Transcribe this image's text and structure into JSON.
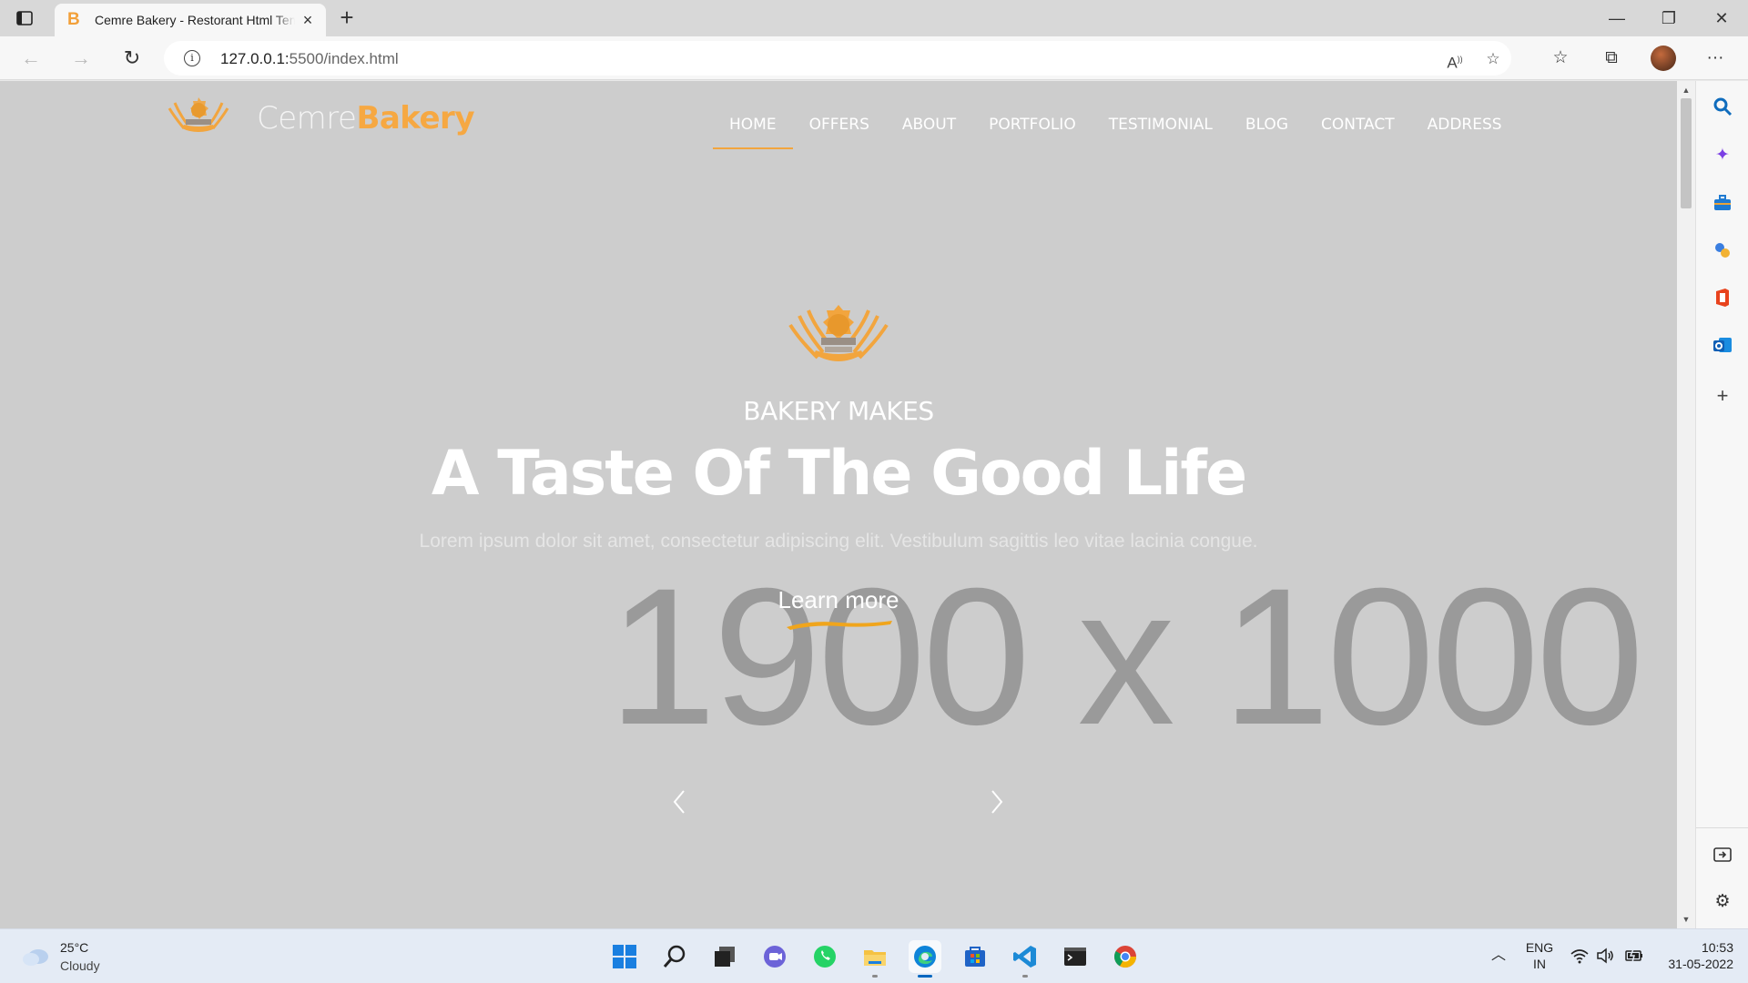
{
  "browser": {
    "tab_title": "Cemre Bakery - Restorant Html Template",
    "tab_favicon_letter": "B",
    "close_tab_glyph": "×",
    "new_tab_glyph": "+",
    "url_host": "127.0.0.1:",
    "url_rest": "5500/index.html",
    "window_controls": {
      "minimize": "—",
      "maximize": "❐",
      "close": "✕"
    },
    "more_glyph": "···"
  },
  "site": {
    "logo_light": "Cemre",
    "logo_bold": "Bakery",
    "nav": [
      {
        "label": "HOME",
        "active": true
      },
      {
        "label": "OFFERS"
      },
      {
        "label": "ABOUT"
      },
      {
        "label": "PORTFOLIO"
      },
      {
        "label": "TESTIMONIAL"
      },
      {
        "label": "BLOG"
      },
      {
        "label": "CONTACT"
      },
      {
        "label": "ADDRESS"
      }
    ],
    "hero": {
      "kicker": "BAKERY MAKES",
      "title": "A Taste Of The Good Life",
      "subtitle": "Lorem ipsum dolor sit amet, consectetur adipiscing elit. Vestibulum sagittis leo vitae lacinia congue.",
      "button": "Learn more",
      "placeholder": "1900 x 1000"
    },
    "colors": {
      "accent": "#f2a53e",
      "hero_bg": "#cdcdcd"
    }
  },
  "taskbar": {
    "temperature": "25°C",
    "condition": "Cloudy",
    "lang_top": "ENG",
    "lang_bottom": "IN",
    "time": "10:53",
    "date": "31-05-2022",
    "apps": [
      "start-icon",
      "search-icon",
      "task-view-icon",
      "teams-chat-icon",
      "whatsapp-icon",
      "file-explorer-icon",
      "edge-icon",
      "store-icon",
      "vscode-icon",
      "terminal-icon",
      "chrome-icon"
    ]
  }
}
